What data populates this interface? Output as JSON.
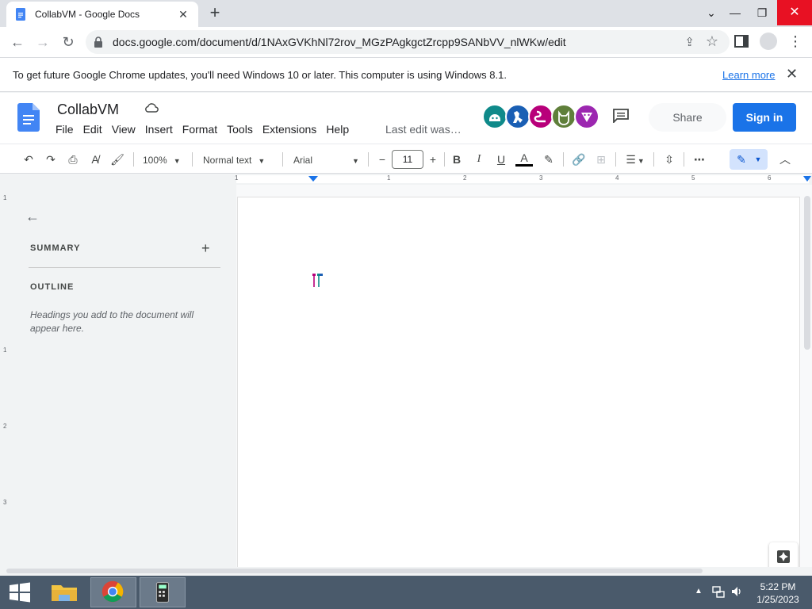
{
  "browser": {
    "tab_title": "CollabVM - Google Docs",
    "url": "docs.google.com/document/d/1NAxGVKhNl72rov_MGzPAgkgctZrcpp9SANbVV_nlWKw/edit"
  },
  "infobar": {
    "message": "To get future Google Chrome updates, you'll need Windows 10 or later. This computer is using Windows 8.1.",
    "link": "Learn more"
  },
  "docs": {
    "title": "CollabVM",
    "menu": [
      "File",
      "Edit",
      "View",
      "Insert",
      "Format",
      "Tools",
      "Extensions",
      "Help"
    ],
    "last_edit": "Last edit was…",
    "share_label": "Share",
    "signin_label": "Sign in",
    "avatars": [
      {
        "color": "#0f8a8a",
        "icon": "ghost-icon"
      },
      {
        "color": "#1a5fb4",
        "icon": "dinosaur-icon"
      },
      {
        "color": "#b8007a",
        "icon": "snake-icon"
      },
      {
        "color": "#5f7f3a",
        "icon": "cat-icon"
      },
      {
        "color": "#9c27b0",
        "icon": "fox-icon"
      }
    ]
  },
  "toolbar": {
    "zoom": "100%",
    "style": "Normal text",
    "font": "Arial",
    "font_size": "11"
  },
  "ruler": {
    "h_labels": [
      "1",
      "1",
      "2",
      "3",
      "4",
      "5",
      "6"
    ],
    "v_labels": [
      "1",
      "1",
      "2",
      "3"
    ]
  },
  "outline": {
    "summary_label": "SUMMARY",
    "outline_label": "OUTLINE",
    "hint": "Headings you add to the document will appear here."
  },
  "taskbar": {
    "time": "5:22 PM",
    "date": "1/25/2023"
  }
}
